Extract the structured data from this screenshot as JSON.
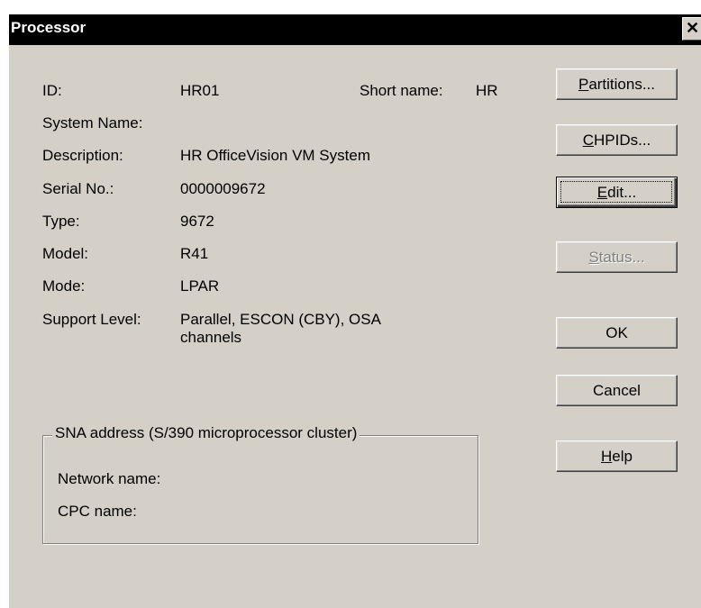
{
  "window": {
    "title": "Processor",
    "close_glyph": "✕"
  },
  "fields": {
    "id_label": "ID:",
    "id_value": "HR01",
    "short_name_label": "Short name:",
    "short_name_value": "HR",
    "system_name_label": "System Name:",
    "system_name_value": "",
    "description_label": "Description:",
    "description_value": "HR OfficeVision VM System",
    "serial_label": "Serial No.:",
    "serial_value": "0000009672",
    "type_label": "Type:",
    "type_value": "9672",
    "model_label": "Model:",
    "model_value": "R41",
    "mode_label": "Mode:",
    "mode_value": "LPAR",
    "support_label": "Support Level:",
    "support_value": "Parallel, ESCON (CBY), OSA channels"
  },
  "sna": {
    "legend": "SNA address (S/390 microprocessor cluster)",
    "network_name_label": "Network name:",
    "network_name_value": "",
    "cpc_name_label": "CPC name:",
    "cpc_name_value": ""
  },
  "buttons": {
    "partitions": {
      "mnemonic": "P",
      "rest": "artitions..."
    },
    "chpids": {
      "mnemonic": "C",
      "rest": "HPIDs..."
    },
    "edit": {
      "mnemonic": "E",
      "rest": "dit..."
    },
    "status": {
      "mnemonic": "S",
      "rest": "tatus..."
    },
    "ok": "OK",
    "cancel": "Cancel",
    "help": {
      "mnemonic": "H",
      "rest": "elp"
    }
  }
}
